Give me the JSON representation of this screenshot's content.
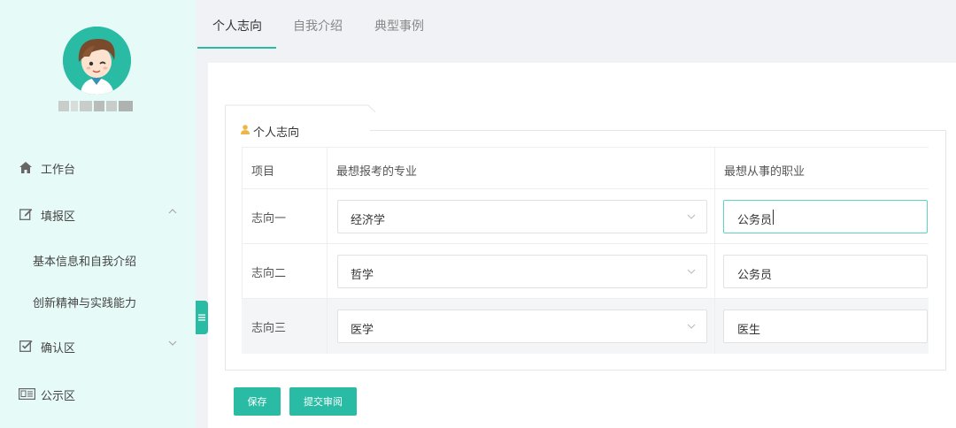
{
  "sidebar": {
    "menu": [
      {
        "label": "工作台",
        "icon": "home-icon"
      },
      {
        "label": "填报区",
        "icon": "edit-icon",
        "expanded": true
      },
      {
        "label": "确认区",
        "icon": "checkbox-icon",
        "expanded": false
      },
      {
        "label": "公示区",
        "icon": "id-card-icon"
      }
    ],
    "submenu": [
      {
        "label": "基本信息和自我介绍"
      },
      {
        "label": "创新精神与实践能力"
      }
    ]
  },
  "tabs": [
    {
      "label": "个人志向",
      "active": true
    },
    {
      "label": "自我介绍",
      "active": false
    },
    {
      "label": "典型事例",
      "active": false
    }
  ],
  "section": {
    "title": "个人志向"
  },
  "table": {
    "headers": [
      "项目",
      "最想报考的专业",
      "最想从事的职业"
    ],
    "rows": [
      {
        "label": "志向一",
        "major": "经济学",
        "career": "公务员"
      },
      {
        "label": "志向二",
        "major": "哲学",
        "career": "公务员"
      },
      {
        "label": "志向三",
        "major": "医学",
        "career": "医生"
      }
    ]
  },
  "buttons": {
    "save": "保存",
    "submit": "提交审阅"
  },
  "colors": {
    "accent": "#2abba5",
    "sidebar_bg": "#e6faf7",
    "legend_icon": "#f0b54a"
  }
}
